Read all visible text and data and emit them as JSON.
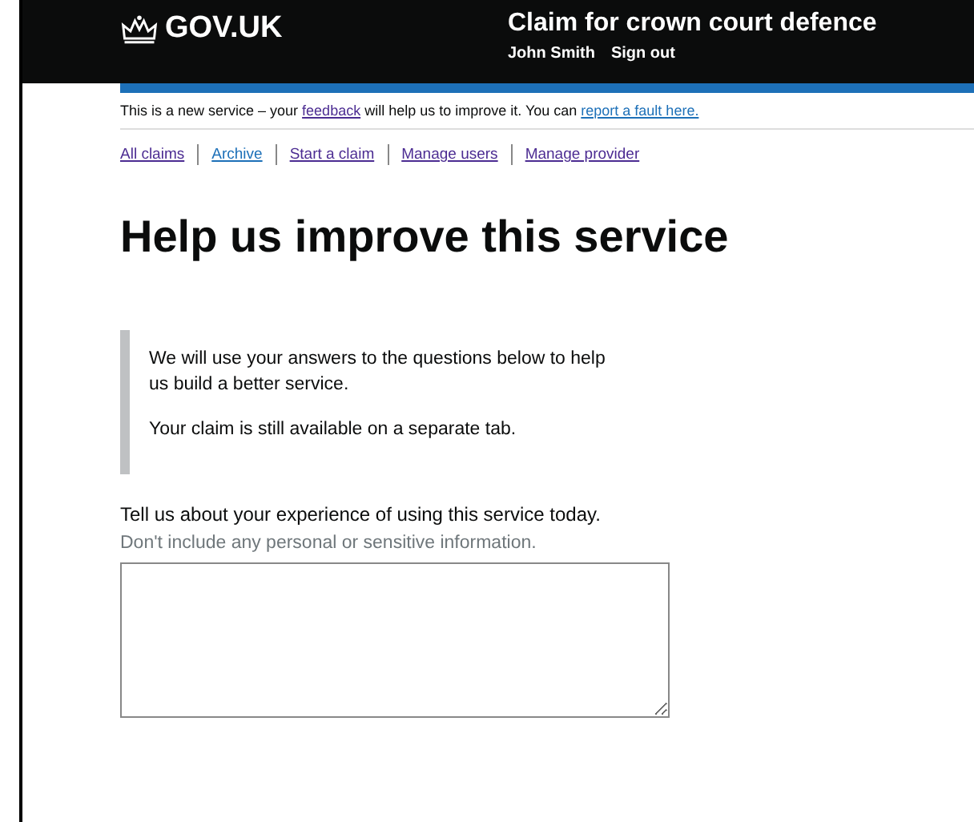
{
  "header": {
    "logo": "GOV.UK",
    "service_name": "Claim for crown court defence",
    "user_name": "John Smith",
    "sign_out": "Sign out"
  },
  "banner": [
    {
      "kind": "text",
      "text": "This is a new service – your "
    },
    {
      "kind": "link",
      "text": "feedback",
      "visited": true
    },
    {
      "kind": "text",
      "text": " will help us to improve it. You can "
    },
    {
      "kind": "link",
      "text": "report a fault here.",
      "visited": false
    }
  ],
  "nav": [
    {
      "label": "All claims",
      "visited": true
    },
    {
      "label": "Archive",
      "visited": false
    },
    {
      "label": "Start a claim",
      "visited": true
    },
    {
      "label": "Manage users",
      "visited": true
    },
    {
      "label": "Manage provider",
      "visited": true
    }
  ],
  "heading": "Help us improve this service",
  "inset": [
    "We will use your answers to the questions below to help us build a better service.",
    "Your claim is still available on a separate tab."
  ],
  "question": {
    "label": "Tell us about your experience of using this service today.",
    "hint": "Don't include any personal or sensitive information."
  }
}
